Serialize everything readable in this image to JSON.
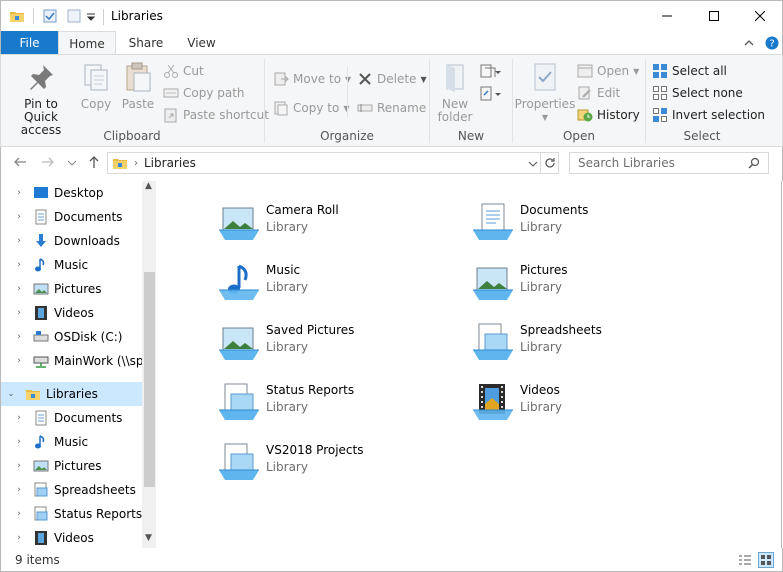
{
  "window": {
    "title": "Libraries"
  },
  "tabs": {
    "file": "File",
    "home": "Home",
    "share": "Share",
    "view": "View"
  },
  "ribbon": {
    "clipboard": {
      "label": "Clipboard",
      "pin": "Pin to Quick access",
      "copy": "Copy",
      "paste": "Paste",
      "cut": "Cut",
      "copy_path": "Copy path",
      "paste_shortcut": "Paste shortcut"
    },
    "organize": {
      "label": "Organize",
      "move_to": "Move to",
      "copy_to": "Copy to",
      "delete": "Delete",
      "rename": "Rename"
    },
    "new": {
      "label": "New",
      "new_folder": "New folder"
    },
    "open": {
      "label": "Open",
      "properties": "Properties",
      "open": "Open",
      "edit": "Edit",
      "history": "History"
    },
    "select": {
      "label": "Select",
      "select_all": "Select all",
      "select_none": "Select none",
      "invert": "Invert selection"
    }
  },
  "address": {
    "path": "Libraries",
    "search_placeholder": "Search Libraries"
  },
  "nav": {
    "items": [
      {
        "label": "Desktop",
        "icon": "desktop-icon"
      },
      {
        "label": "Documents",
        "icon": "documents-icon"
      },
      {
        "label": "Downloads",
        "icon": "downloads-icon"
      },
      {
        "label": "Music",
        "icon": "music-icon"
      },
      {
        "label": "Pictures",
        "icon": "pictures-icon"
      },
      {
        "label": "Videos",
        "icon": "videos-icon"
      },
      {
        "label": "OSDisk (C:)",
        "icon": "drive-icon"
      },
      {
        "label": "MainWork (\\\\spa",
        "icon": "network-drive-icon"
      },
      {
        "label": "Libraries",
        "icon": "libraries-icon"
      },
      {
        "label": "Documents",
        "icon": "documents-icon"
      },
      {
        "label": "Music",
        "icon": "music-icon"
      },
      {
        "label": "Pictures",
        "icon": "pictures-icon"
      },
      {
        "label": "Spreadsheets",
        "icon": "library-icon"
      },
      {
        "label": "Status Reports",
        "icon": "library-icon"
      },
      {
        "label": "Videos",
        "icon": "videos-icon"
      }
    ]
  },
  "libraries": [
    {
      "name": "Camera Roll",
      "type": "Library",
      "icon": "pictures-library-icon"
    },
    {
      "name": "Documents",
      "type": "Library",
      "icon": "documents-library-icon"
    },
    {
      "name": "Music",
      "type": "Library",
      "icon": "music-library-icon"
    },
    {
      "name": "Pictures",
      "type": "Library",
      "icon": "pictures-library-icon"
    },
    {
      "name": "Saved Pictures",
      "type": "Library",
      "icon": "pictures-library-icon"
    },
    {
      "name": "Spreadsheets",
      "type": "Library",
      "icon": "generic-library-icon"
    },
    {
      "name": "Status Reports",
      "type": "Library",
      "icon": "generic-library-icon"
    },
    {
      "name": "Videos",
      "type": "Library",
      "icon": "videos-library-icon"
    },
    {
      "name": "VS2018 Projects",
      "type": "Library",
      "icon": "generic-library-icon"
    }
  ],
  "status": {
    "count": "9 items"
  },
  "colors": {
    "accent": "#1979ca",
    "selection": "#cce8ff",
    "ribbon_bg": "#f5f6f7"
  }
}
